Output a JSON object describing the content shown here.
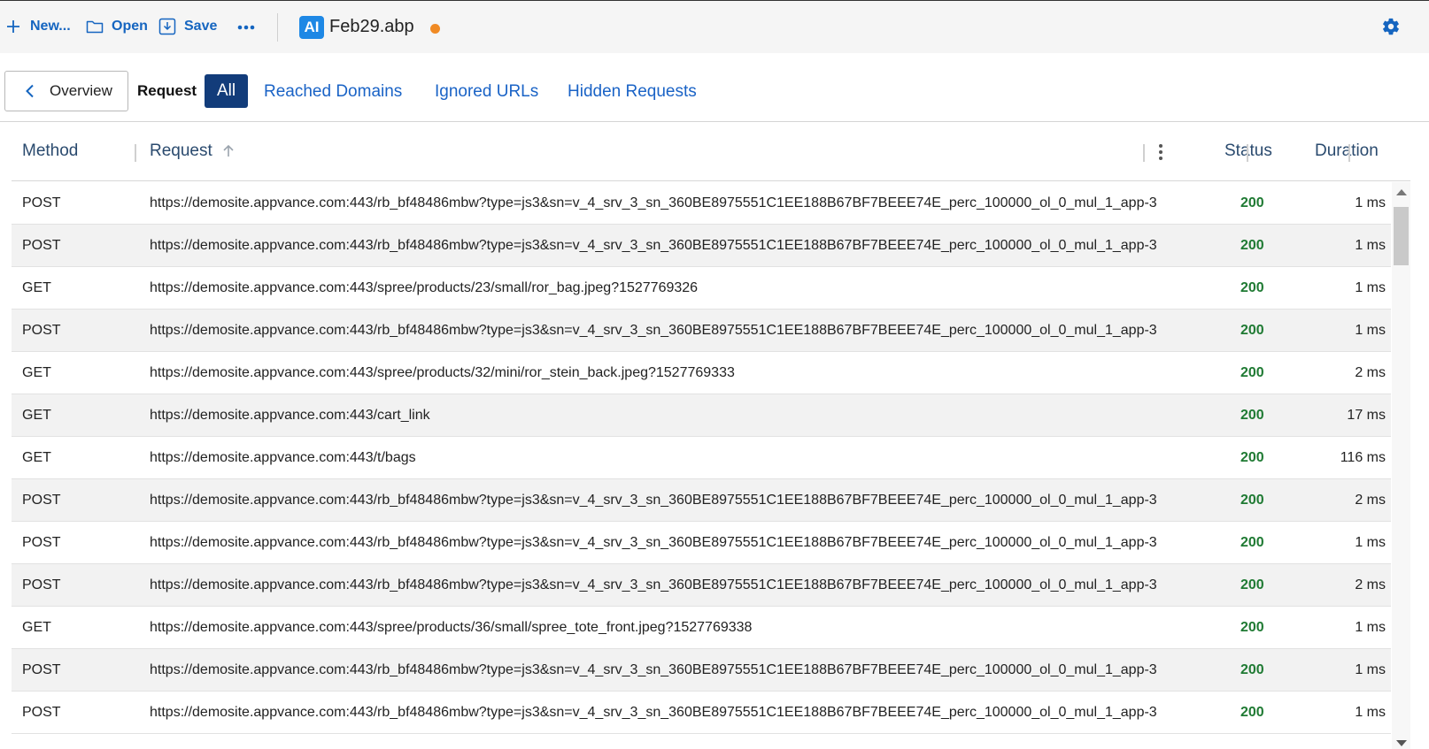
{
  "toolbar": {
    "new_label": "New...",
    "open_label": "Open",
    "save_label": "Save",
    "more_icon": "more-horizontal-icon",
    "doc_badge": "AI",
    "doc_title": "Feb29.abp",
    "unsaved_dot_color": "#f08a24",
    "settings_icon": "gear-icon"
  },
  "tabs": {
    "overview_label": "Overview",
    "request_label": "Request",
    "all_label": "All",
    "reached_label": "Reached Domains",
    "ignored_label": "Ignored URLs",
    "hidden_label": "Hidden Requests"
  },
  "table": {
    "headers": {
      "method": "Method",
      "request": "Request",
      "status": "Status",
      "duration": "Duration"
    },
    "rows": [
      {
        "method": "POST",
        "url": "https://demosite.appvance.com:443/rb_bf48486mbw?type=js3&sn=v_4_srv_3_sn_360BE8975551C1EE188B67BF7BEEE74E_perc_100000_ol_0_mul_1_app-3",
        "status": "200",
        "duration": "1 ms"
      },
      {
        "method": "POST",
        "url": "https://demosite.appvance.com:443/rb_bf48486mbw?type=js3&sn=v_4_srv_3_sn_360BE8975551C1EE188B67BF7BEEE74E_perc_100000_ol_0_mul_1_app-3",
        "status": "200",
        "duration": "1 ms"
      },
      {
        "method": "GET",
        "url": "https://demosite.appvance.com:443/spree/products/23/small/ror_bag.jpeg?1527769326",
        "status": "200",
        "duration": "1 ms"
      },
      {
        "method": "POST",
        "url": "https://demosite.appvance.com:443/rb_bf48486mbw?type=js3&sn=v_4_srv_3_sn_360BE8975551C1EE188B67BF7BEEE74E_perc_100000_ol_0_mul_1_app-3",
        "status": "200",
        "duration": "1 ms"
      },
      {
        "method": "GET",
        "url": "https://demosite.appvance.com:443/spree/products/32/mini/ror_stein_back.jpeg?1527769333",
        "status": "200",
        "duration": "2 ms"
      },
      {
        "method": "GET",
        "url": "https://demosite.appvance.com:443/cart_link",
        "status": "200",
        "duration": "17 ms"
      },
      {
        "method": "GET",
        "url": "https://demosite.appvance.com:443/t/bags",
        "status": "200",
        "duration": "116 ms"
      },
      {
        "method": "POST",
        "url": "https://demosite.appvance.com:443/rb_bf48486mbw?type=js3&sn=v_4_srv_3_sn_360BE8975551C1EE188B67BF7BEEE74E_perc_100000_ol_0_mul_1_app-3",
        "status": "200",
        "duration": "2 ms"
      },
      {
        "method": "POST",
        "url": "https://demosite.appvance.com:443/rb_bf48486mbw?type=js3&sn=v_4_srv_3_sn_360BE8975551C1EE188B67BF7BEEE74E_perc_100000_ol_0_mul_1_app-3",
        "status": "200",
        "duration": "1 ms"
      },
      {
        "method": "POST",
        "url": "https://demosite.appvance.com:443/rb_bf48486mbw?type=js3&sn=v_4_srv_3_sn_360BE8975551C1EE188B67BF7BEEE74E_perc_100000_ol_0_mul_1_app-3",
        "status": "200",
        "duration": "2 ms"
      },
      {
        "method": "GET",
        "url": "https://demosite.appvance.com:443/spree/products/36/small/spree_tote_front.jpeg?1527769338",
        "status": "200",
        "duration": "1 ms"
      },
      {
        "method": "POST",
        "url": "https://demosite.appvance.com:443/rb_bf48486mbw?type=js3&sn=v_4_srv_3_sn_360BE8975551C1EE188B67BF7BEEE74E_perc_100000_ol_0_mul_1_app-3",
        "status": "200",
        "duration": "1 ms"
      },
      {
        "method": "POST",
        "url": "https://demosite.appvance.com:443/rb_bf48486mbw?type=js3&sn=v_4_srv_3_sn_360BE8975551C1EE188B67BF7BEEE74E_perc_100000_ol_0_mul_1_app-3",
        "status": "200",
        "duration": "1 ms"
      }
    ]
  },
  "colors": {
    "accent": "#1565c0",
    "active_tab": "#123c7a",
    "status_ok": "#1f7a33"
  }
}
